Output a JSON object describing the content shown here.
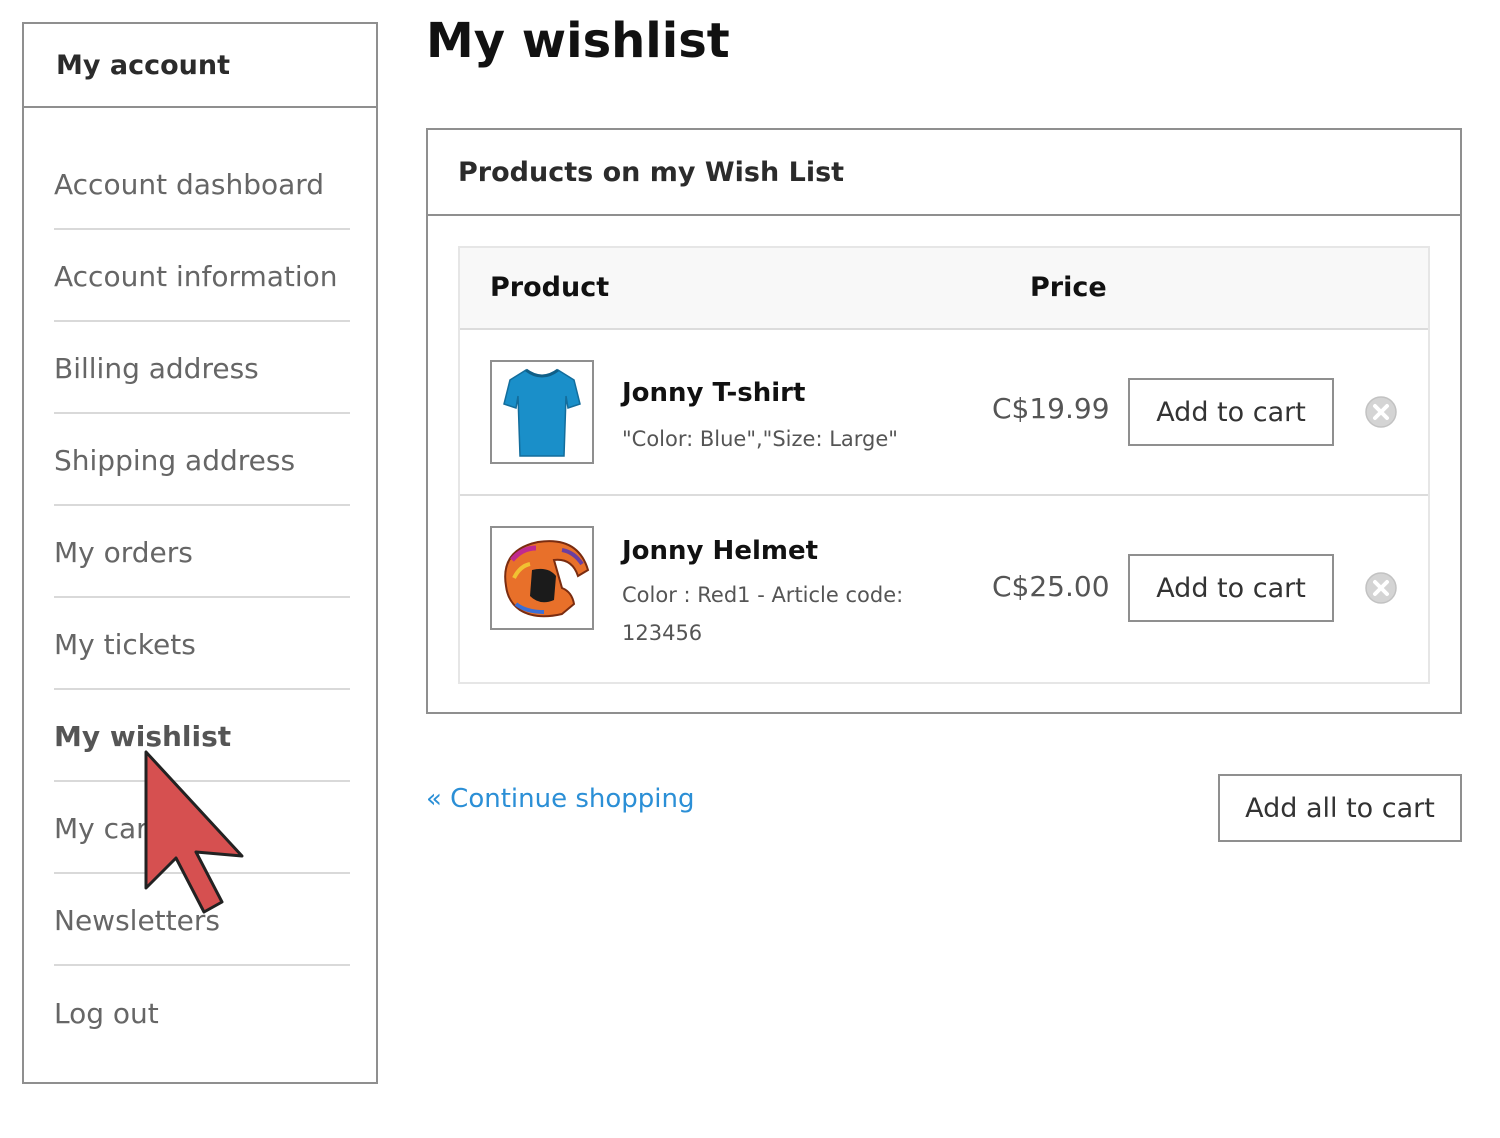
{
  "sidebar": {
    "title": "My account",
    "items": [
      {
        "label": "Account dashboard"
      },
      {
        "label": "Account information"
      },
      {
        "label": "Billing address"
      },
      {
        "label": "Shipping address"
      },
      {
        "label": "My orders"
      },
      {
        "label": "My tickets"
      },
      {
        "label": "My wishlist",
        "active": true
      },
      {
        "label": "My cart"
      },
      {
        "label": "Newsletters"
      },
      {
        "label": "Log out"
      }
    ]
  },
  "page": {
    "title": "My wishlist"
  },
  "wishlist": {
    "panel_title": "Products on my Wish List",
    "columns": {
      "product": "Product",
      "price": "Price"
    },
    "items": [
      {
        "name": "Jonny T-shirt",
        "options": "\"Color: Blue\",\"Size: Large\"",
        "price": "C$19.99",
        "add_label": "Add to cart",
        "thumb_icon": "tshirt-icon",
        "thumb_color": "#1a8fc9"
      },
      {
        "name": "Jonny Helmet",
        "options": "Color : Red1 - Article code: 123456",
        "price": "C$25.00",
        "add_label": "Add to cart",
        "thumb_icon": "helmet-icon",
        "thumb_color": "#e8702a"
      }
    ]
  },
  "footer": {
    "continue_label": "« Continue shopping",
    "add_all_label": "Add all to cart"
  },
  "colors": {
    "link": "#2b8fd6",
    "border": "#8f8f8f",
    "cursor_fill": "#d65050"
  }
}
